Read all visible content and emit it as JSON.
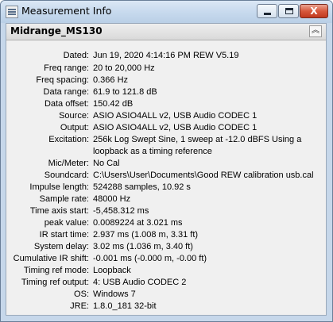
{
  "window": {
    "title": "Measurement Info",
    "buttons": {
      "minimize": "minimize-icon",
      "maximize": "maximize-icon",
      "close": "close-icon"
    },
    "close_glyph": "X"
  },
  "panel": {
    "title": "Midrange_MS130",
    "collapse_glyph": "︽"
  },
  "fields": [
    {
      "label": "Dated:",
      "value": "Jun 19, 2020 4:14:16 PM REW V5.19"
    },
    {
      "label": "Freq range:",
      "value": "20 to 20,000 Hz"
    },
    {
      "label": "Freq spacing:",
      "value": "0.366 Hz"
    },
    {
      "label": "Data range:",
      "value": "61.9 to 121.8 dB"
    },
    {
      "label": "Data offset:",
      "value": "150.42 dB"
    },
    {
      "label": "Source:",
      "value": "ASIO ASIO4ALL v2, USB Audio CODEC  1"
    },
    {
      "label": "Output:",
      "value": "ASIO ASIO4ALL v2, USB Audio CODEC  1"
    },
    {
      "label": "Excitation:",
      "value": "256k Log Swept Sine, 1 sweep at -12.0 dBFS  Using a",
      "value2": "loopback as a timing reference"
    },
    {
      "label": "Mic/Meter:",
      "value": "No Cal"
    },
    {
      "label": "Soundcard:",
      "value": "C:\\Users\\User\\Documents\\Good REW calibration usb.cal"
    },
    {
      "label": "Impulse length:",
      "value": "524288 samples, 10.92 s"
    },
    {
      "label": "Sample rate:",
      "value": "48000 Hz"
    },
    {
      "label": "Time axis start:",
      "value": "-5,458.312 ms"
    },
    {
      "label": "peak value:",
      "value": "0.0089224 at 3.021 ms"
    },
    {
      "label": "IR start time:",
      "value": "2.937 ms (1.008 m, 3.31 ft)"
    },
    {
      "label": "System delay:",
      "value": "3.02 ms (1.036 m, 3.40 ft)"
    },
    {
      "label": "Cumulative IR shift:",
      "value": "-0.001 ms (-0.000 m, -0.00 ft)"
    },
    {
      "label": "Timing ref mode:",
      "value": "Loopback"
    },
    {
      "label": "Timing ref output:",
      "value": "4: USB Audio CODEC  2"
    },
    {
      "label": "OS:",
      "value": "Windows 7"
    },
    {
      "label": "JRE:",
      "value": "1.8.0_181 32-bit"
    }
  ]
}
